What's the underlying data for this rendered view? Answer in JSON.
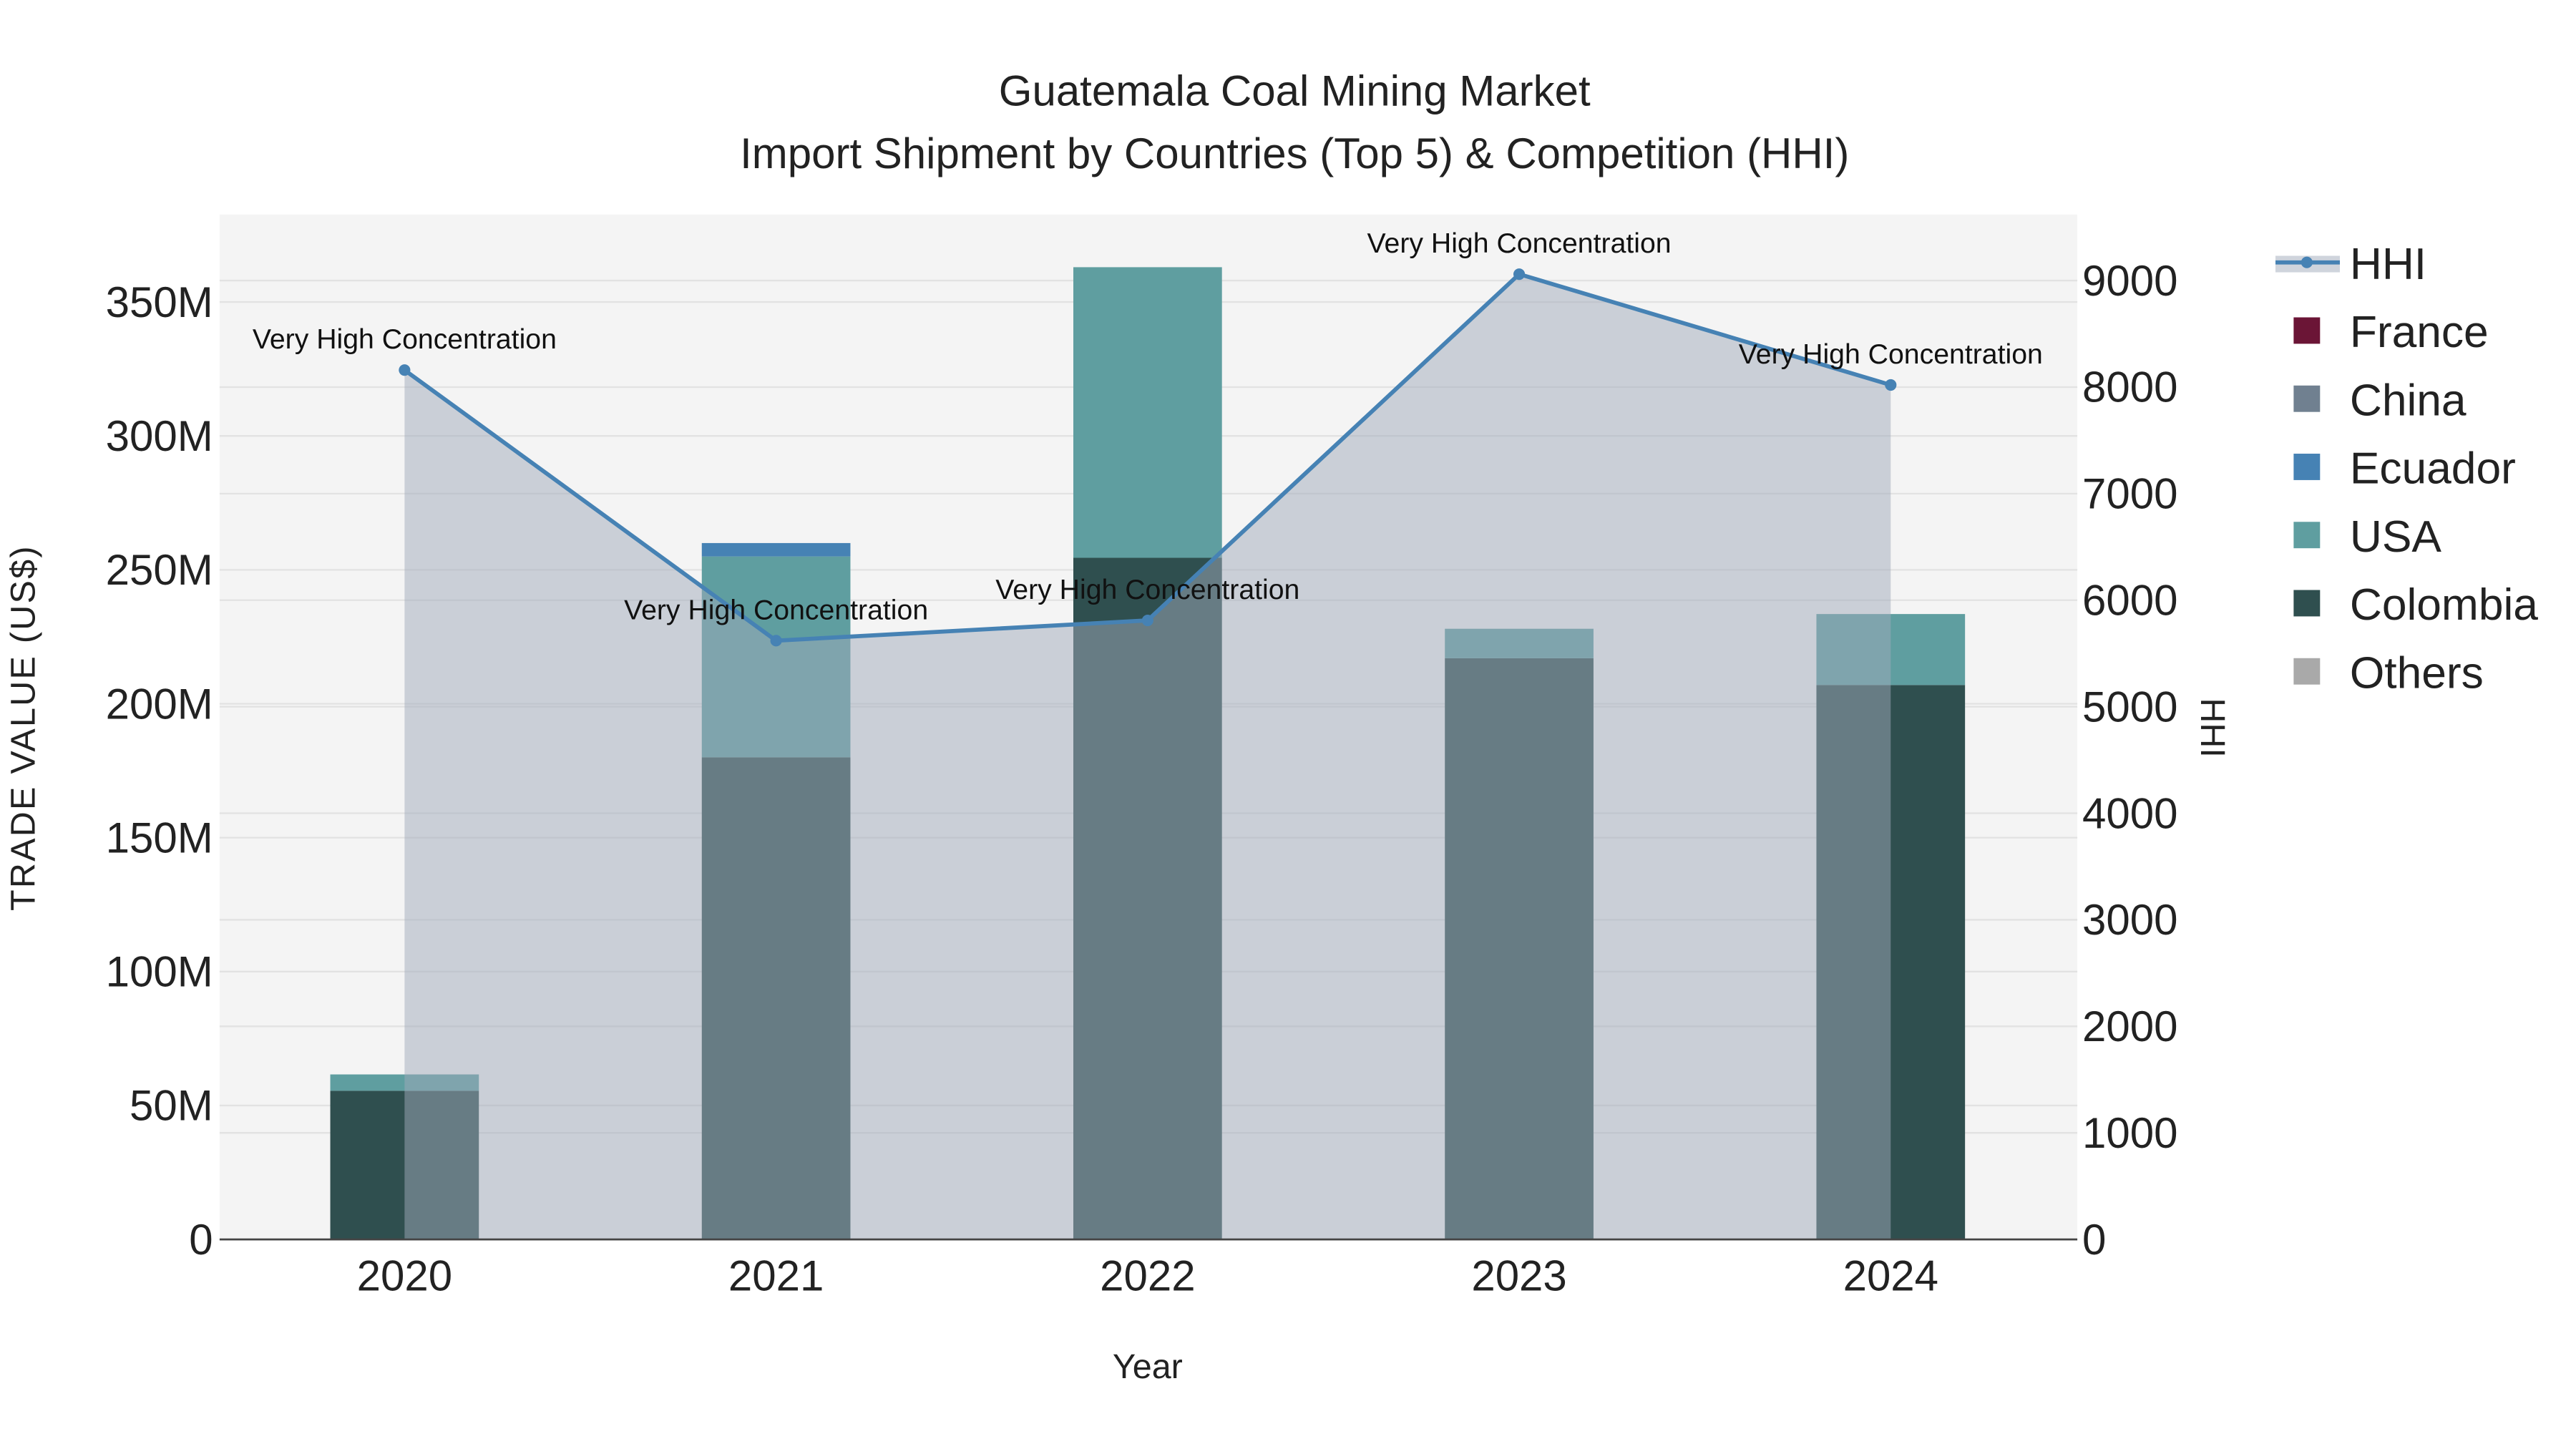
{
  "chart_data": {
    "type": "bar",
    "title": "Guatemala Coal Mining Market",
    "subtitle": "Import Shipment by Countries (Top 5) & Competition (HHI)",
    "xlabel": "Year",
    "ylabel": "TRADE VALUE (US$)",
    "y2label": "HHI",
    "categories": [
      "2020",
      "2021",
      "2022",
      "2023",
      "2024"
    ],
    "ylim": [
      0,
      380
    ],
    "y2lim": [
      0,
      9600
    ],
    "yticks": [
      0,
      50,
      100,
      150,
      200,
      250,
      300,
      350
    ],
    "ytick_labels": [
      "0",
      "50M",
      "100M",
      "150M",
      "200M",
      "250M",
      "300M",
      "350M"
    ],
    "y2ticks": [
      0,
      1000,
      2000,
      3000,
      4000,
      5000,
      6000,
      7000,
      8000,
      9000
    ],
    "y2tick_labels": [
      "0",
      "1000",
      "2000",
      "3000",
      "4000",
      "5000",
      "6000",
      "7000",
      "8000",
      "9000"
    ],
    "barmode": "stack",
    "units": "million US$",
    "series": [
      {
        "name": "Colombia",
        "color": "#2f4f4f",
        "values": [
          55.5,
          180,
          254.5,
          217,
          207
        ]
      },
      {
        "name": "USA",
        "color": "#5f9ea0",
        "values": [
          6.1,
          75,
          108.5,
          11,
          26.5
        ]
      },
      {
        "name": "Ecuador",
        "color": "#4682b4",
        "values": [
          0,
          5,
          0,
          0,
          0
        ]
      },
      {
        "name": "China",
        "color": "#708090",
        "values": [
          0,
          0,
          0,
          0,
          0
        ]
      },
      {
        "name": "France",
        "color": "#6b1536",
        "values": [
          0,
          0,
          0,
          0,
          0
        ]
      },
      {
        "name": "Others",
        "color": "#a9a9a9",
        "values": [
          0,
          0,
          0,
          0,
          0
        ]
      }
    ],
    "hhi": {
      "name": "HHI",
      "color": "#4682b4",
      "values": [
        8160,
        5620,
        5810,
        9060,
        8020
      ],
      "annotations": [
        "Very High Concentration",
        "Very High Concentration",
        "Very High Concentration",
        "Very High Concentration",
        "Very High Concentration"
      ]
    },
    "legend": {
      "position": "right",
      "entries": [
        "HHI",
        "France",
        "China",
        "Ecuador",
        "USA",
        "Colombia",
        "Others"
      ]
    },
    "grid": true
  }
}
